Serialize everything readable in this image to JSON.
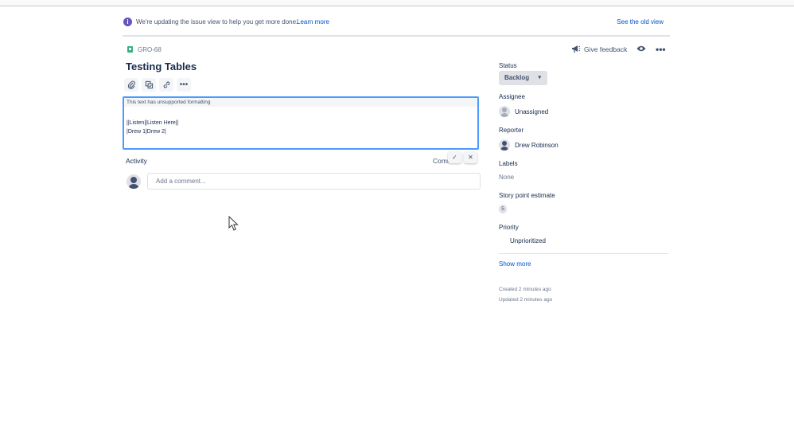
{
  "banner": {
    "text": "We're updating the issue view to help you get more done.",
    "learn_more": "Learn more",
    "see_old_view": "See the old view"
  },
  "issue": {
    "key": "GRO-68",
    "title": "Testing Tables"
  },
  "toolbar": {
    "icons": [
      "attachment-icon",
      "subtask-icon",
      "link-icon",
      "more-icon"
    ]
  },
  "editor": {
    "unsupported_note": "This text has unsupported formatting",
    "line1": "||Listen||Listen Here||",
    "line2": "|Drew 1|Drew 2|"
  },
  "activity": {
    "label": "Activity",
    "comments_label": "Comm",
    "comment_placeholder": "Add a comment..."
  },
  "sidebar": {
    "give_feedback": "Give feedback",
    "status_label": "Status",
    "status_value": "Backlog",
    "assignee_label": "Assignee",
    "assignee_value": "Unassigned",
    "reporter_label": "Reporter",
    "reporter_value": "Drew Robinson",
    "labels_label": "Labels",
    "labels_value": "None",
    "story_points_label": "Story point estimate",
    "story_points_value": "5",
    "priority_label": "Priority",
    "priority_value": "Unprioritized",
    "show_more": "Show more",
    "created": "Created 2 minutes ago",
    "updated": "Updated 2 minutes ago"
  },
  "colors": {
    "accent": "#0052cc",
    "info": "#6554c0",
    "editor_border": "#4c9aff",
    "story_icon": "#36b37e"
  }
}
